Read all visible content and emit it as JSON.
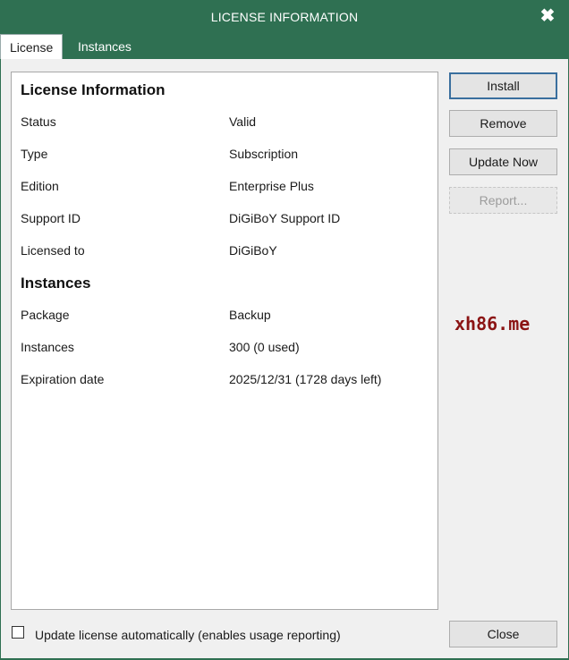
{
  "window": {
    "title": "LICENSE INFORMATION",
    "close_glyph": "✖"
  },
  "tabs": [
    {
      "label": "License",
      "active": true
    },
    {
      "label": "Instances",
      "active": false
    }
  ],
  "license_section": {
    "heading": "License Information",
    "rows": [
      {
        "label": "Status",
        "value": "Valid"
      },
      {
        "label": "Type",
        "value": "Subscription"
      },
      {
        "label": "Edition",
        "value": "Enterprise Plus"
      },
      {
        "label": "Support ID",
        "value": "DiGiBoY Support ID"
      },
      {
        "label": "Licensed to",
        "value": "DiGiBoY"
      }
    ]
  },
  "instances_section": {
    "heading": "Instances",
    "rows": [
      {
        "label": "Package",
        "value": "Backup"
      },
      {
        "label": "Instances",
        "value": "300 (0 used)"
      },
      {
        "label": "Expiration date",
        "value": "2025/12/31 (1728 days left)"
      }
    ]
  },
  "buttons": {
    "install": "Install",
    "remove": "Remove",
    "update_now": "Update Now",
    "report": "Report...",
    "close": "Close"
  },
  "auto_update": {
    "label": "Update license automatically (enables usage reporting)",
    "checked": false
  },
  "watermark": "xh86.me",
  "colors": {
    "titlebar": "#2f7052",
    "panel_bg": "#ffffff",
    "dialog_bg": "#f0f0f0",
    "watermark": "#8b1414"
  }
}
